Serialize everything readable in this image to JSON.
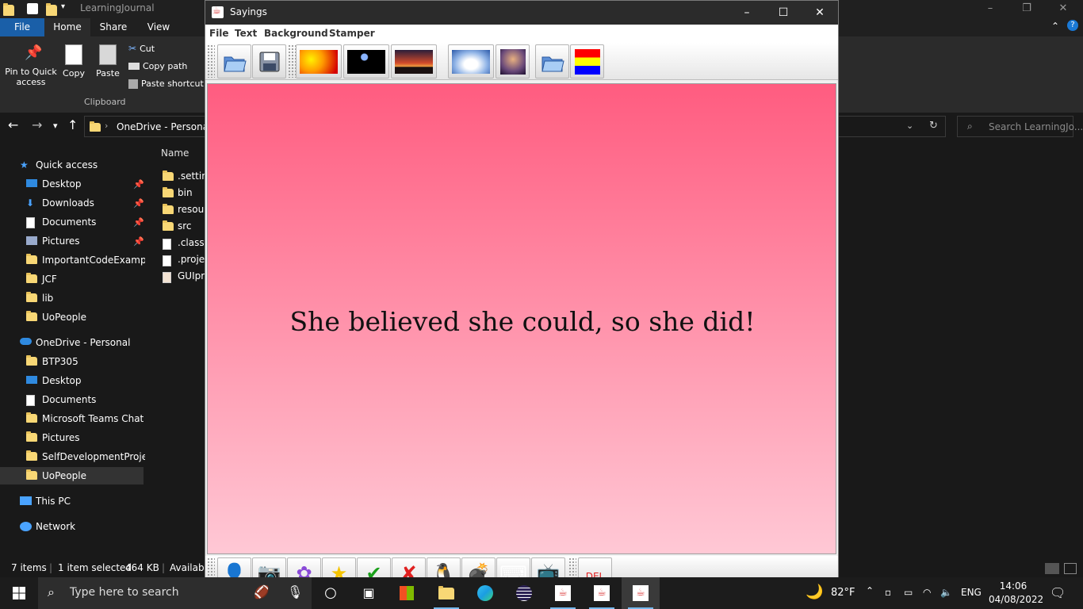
{
  "explorer": {
    "title": "LearningJournal",
    "ribbon_tabs": [
      "File",
      "Home",
      "Share",
      "View"
    ],
    "clipboard": {
      "pin_label_1": "Pin to Quick",
      "pin_label_2": "access",
      "copy": "Copy",
      "paste": "Paste",
      "cut": "Cut",
      "copy_path": "Copy path",
      "paste_shortcut": "Paste shortcut",
      "group_label": "Clipboard"
    },
    "address": "OneDrive - Personal",
    "search_placeholder": "Search LearningJo...",
    "nav": [
      {
        "label": "Quick access"
      },
      {
        "label": "Desktop"
      },
      {
        "label": "Downloads"
      },
      {
        "label": "Documents"
      },
      {
        "label": "Pictures"
      },
      {
        "label": "ImportantCodeExamples"
      },
      {
        "label": "JCF"
      },
      {
        "label": "lib"
      },
      {
        "label": "UoPeople"
      },
      {
        "label": "OneDrive - Personal"
      },
      {
        "label": "BTP305"
      },
      {
        "label": "Desktop"
      },
      {
        "label": "Documents"
      },
      {
        "label": "Microsoft Teams Chat Fil"
      },
      {
        "label": "Pictures"
      },
      {
        "label": "SelfDevelopmentProjects"
      },
      {
        "label": "UoPeople"
      },
      {
        "label": "This PC"
      },
      {
        "label": "Network"
      }
    ],
    "column_name": "Name",
    "files": [
      ".settin",
      "bin",
      "resour",
      "src",
      ".classp",
      ".projec",
      "GUIpro"
    ],
    "status": {
      "items": "7 items",
      "selected": "1 item selected",
      "size": "464 KB",
      "avail": "Availabl"
    }
  },
  "sayings": {
    "title": "Sayings",
    "menus": [
      "File",
      "Text",
      "Background",
      "Stamper"
    ],
    "text": "She believed she could, so she did!",
    "colors": {
      "gradient_top": "#ff5c80",
      "gradient_bottom": "#ffc8d5"
    }
  },
  "taskbar": {
    "search_placeholder": "Type here to search",
    "temperature": "82°F",
    "language": "ENG",
    "time": "14:06",
    "date": "04/08/2022"
  }
}
